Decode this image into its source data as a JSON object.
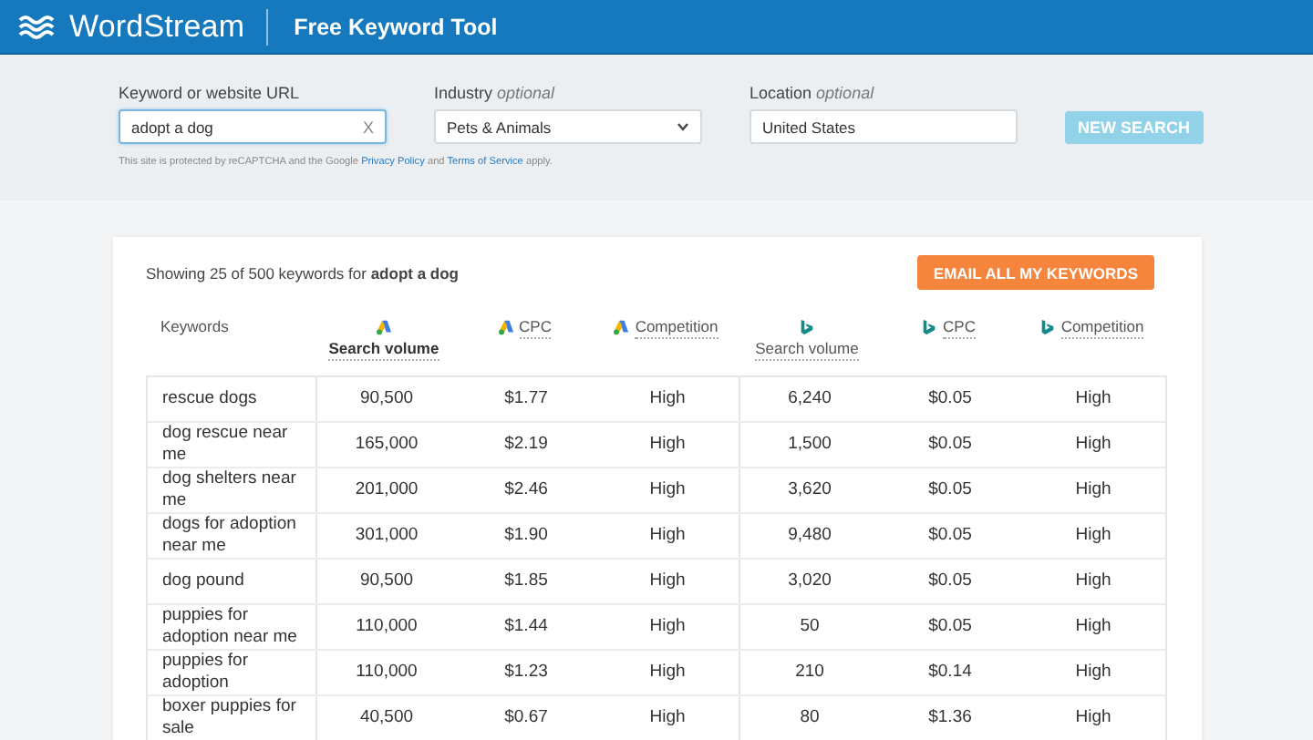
{
  "header": {
    "brand": "WordStream",
    "title": "Free Keyword Tool"
  },
  "form": {
    "keyword": {
      "label": "Keyword or website URL",
      "value": "adopt a dog",
      "clear": "X"
    },
    "industry": {
      "label": "Industry",
      "hint": "optional",
      "value": "Pets & Animals"
    },
    "location": {
      "label": "Location",
      "hint": "optional",
      "value": "United States"
    },
    "search_button": {
      "label": "NEW SEARCH",
      "disabled": true
    },
    "notice": [
      {
        "kind": "text",
        "text": "This site is protected by reCAPTCHA and the Google "
      },
      {
        "kind": "link",
        "text": "Privacy Policy"
      },
      {
        "kind": "text",
        "text": " and "
      },
      {
        "kind": "link",
        "text": "Terms of Service"
      },
      {
        "kind": "text",
        "text": " apply."
      }
    ]
  },
  "results": {
    "summary": "Showing 25 of 500 keywords for **adopt a dog**",
    "email_button": "EMAIL ALL MY KEYWORDS",
    "columns": [
      {
        "label": "Keywords",
        "kind": "plain",
        "sorted": false
      },
      {
        "label": "Search volume",
        "kind": "google",
        "sorted": true
      },
      {
        "label": "CPC",
        "kind": "google",
        "sorted": false
      },
      {
        "label": "Competition",
        "kind": "google",
        "sorted": false
      },
      {
        "label": "Search volume",
        "kind": "bing",
        "sorted": false
      },
      {
        "label": "CPC",
        "kind": "bing",
        "sorted": false
      },
      {
        "label": "Competition",
        "kind": "bing",
        "sorted": false
      }
    ],
    "rows": [
      [
        "rescue dogs",
        "90,500",
        "$1.77",
        "High",
        "6,240",
        "$0.05",
        "High"
      ],
      [
        "dog rescue near me",
        "165,000",
        "$2.19",
        "High",
        "1,500",
        "$0.05",
        "High"
      ],
      [
        "dog shelters near me",
        "201,000",
        "$2.46",
        "High",
        "3,620",
        "$0.05",
        "High"
      ],
      [
        "dogs for adoption near me",
        "301,000",
        "$1.90",
        "High",
        "9,480",
        "$0.05",
        "High"
      ],
      [
        "dog pound",
        "90,500",
        "$1.85",
        "High",
        "3,020",
        "$0.05",
        "High"
      ],
      [
        "puppies for adoption near me",
        "110,000",
        "$1.44",
        "High",
        "50",
        "$0.05",
        "High"
      ],
      [
        "puppies for adoption",
        "110,000",
        "$1.23",
        "High",
        "210",
        "$0.14",
        "High"
      ],
      [
        "boxer puppies for sale",
        "40,500",
        "$0.67",
        "High",
        "80",
        "$1.36",
        "High"
      ]
    ]
  }
}
